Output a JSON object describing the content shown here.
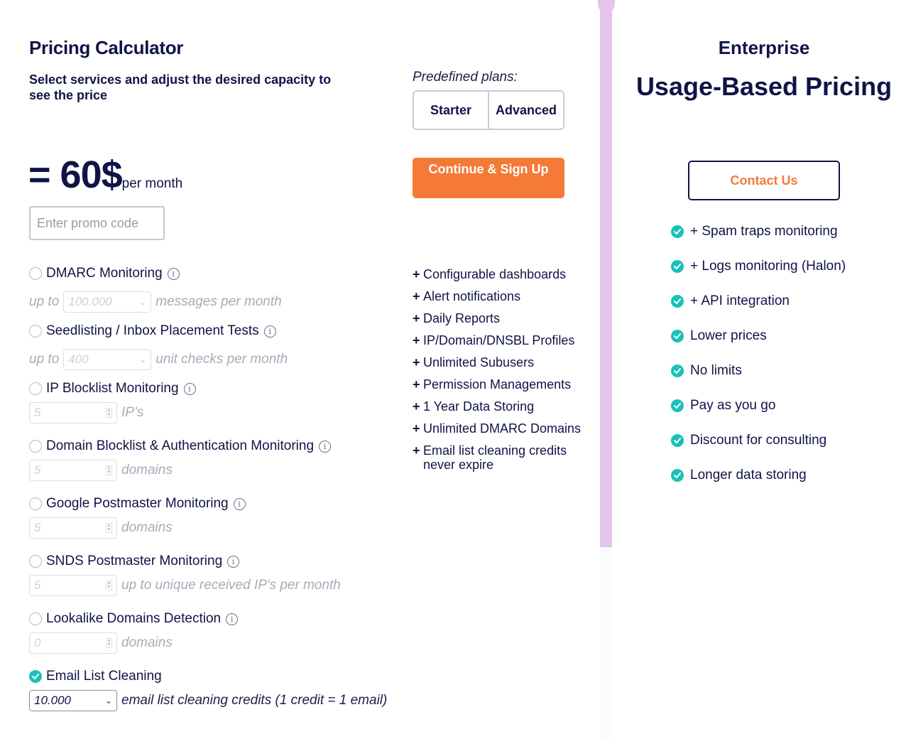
{
  "calculator": {
    "title": "Pricing Calculator",
    "subtitle": "Select services and adjust the desired capacity to see the price",
    "predefined_label": "Predefined plans:",
    "plans": [
      "Starter",
      "Advanced"
    ],
    "price": "= 60$",
    "price_unit": "per month",
    "cta_label": "Continue & Sign Up",
    "promo_placeholder": "Enter promo code",
    "info_glyph": "i",
    "services": [
      {
        "name": "DMARC Monitoring",
        "prefix": "up to",
        "value": "100.000",
        "suffix": "messages per month",
        "control": "select",
        "selected": false
      },
      {
        "name": "Seedlisting / Inbox Placement Tests",
        "prefix": "up to",
        "value": "400",
        "suffix": "unit checks per month",
        "control": "select",
        "selected": false
      },
      {
        "name": "IP Blocklist Monitoring",
        "value": "5",
        "suffix": "IP's",
        "control": "number",
        "selected": false
      },
      {
        "name": "Domain Blocklist & Authentication Monitoring",
        "value": "5",
        "suffix": "domains",
        "control": "number",
        "selected": false
      },
      {
        "name": "Google Postmaster Monitoring",
        "value": "5",
        "suffix": "domains",
        "control": "number",
        "selected": false
      },
      {
        "name": "SNDS Postmaster Monitoring",
        "value": "5",
        "suffix": "up to unique received IP's per month",
        "control": "number",
        "selected": false
      },
      {
        "name": "Lookalike Domains Detection",
        "value": "0",
        "suffix": "domains",
        "control": "number",
        "selected": false
      },
      {
        "name": "Email List Cleaning",
        "value": "10.000",
        "suffix": "email list cleaning credits (1 credit = 1 email)",
        "control": "select",
        "selected": true
      }
    ],
    "features": [
      "Configurable dashboards",
      "Alert notifications",
      "Daily Reports",
      "IP/Domain/DNSBL Profiles",
      "Unlimited Subusers",
      "Permission Managements",
      "1 Year Data Storing",
      "Unlimited DMARC Domains",
      "Email list cleaning credits never expire"
    ],
    "feature_prefix": "+"
  },
  "enterprise": {
    "title": "Enterprise",
    "headline": "Usage-Based Pricing",
    "contact_label": "Contact Us",
    "items": [
      "+ Spam traps monitoring",
      "+ Logs monitoring (Halon)",
      "+ API integration",
      "Lower prices",
      "No limits",
      "Pay as you go",
      "Discount for consulting",
      "Longer data storing"
    ]
  },
  "colors": {
    "navy": "#0f1446",
    "orange": "#f57a37",
    "teal": "#19c2b6",
    "divider": "#e4c4ec"
  },
  "icons": {
    "check": "check-circle-icon",
    "info": "info-icon",
    "chevron": "chevron-down-icon"
  }
}
